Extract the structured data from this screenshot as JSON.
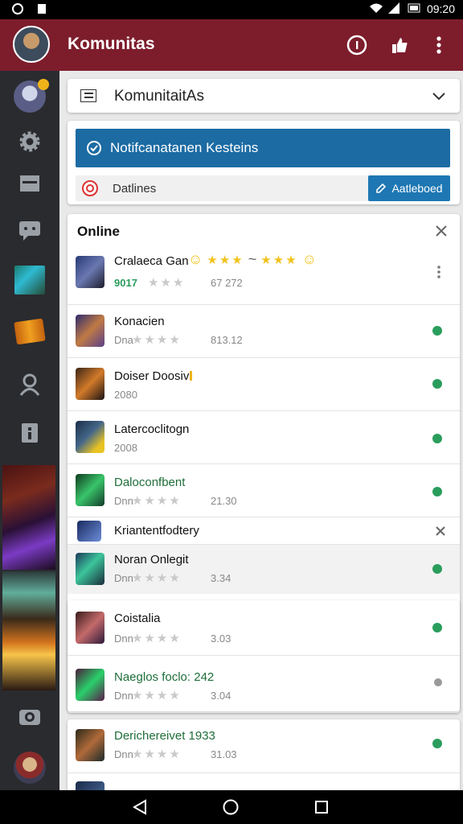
{
  "statusbar": {
    "time": "09:20"
  },
  "appbar": {
    "title": "Komunitas"
  },
  "dropdown": {
    "label": "KomunitaitAs"
  },
  "notification": {
    "label": "Notifcanatanen Kesteins"
  },
  "deal": {
    "label": "Datlines",
    "button": "Aatleboed"
  },
  "online": {
    "header": "Online",
    "rows": [
      {
        "name": "Cralaeca Gan",
        "sub": "9017",
        "meta": "67 272",
        "status": "menu"
      },
      {
        "name": "Konacien",
        "sub": "Dna",
        "meta": "813.12",
        "status": "green"
      },
      {
        "name": "Doiser Doosiv",
        "sub": "2080",
        "meta": "",
        "status": "green"
      },
      {
        "name": "Latercoclitogn",
        "sub": "2008",
        "meta": "",
        "status": "green"
      },
      {
        "name": "Daloconfbent",
        "sub": "Dnn",
        "meta": "21.30",
        "status": "green"
      },
      {
        "name": "Kriantentfodtery",
        "sub": "",
        "meta": "",
        "status": "close"
      },
      {
        "name": "Noran Onlegit",
        "sub": "Dnn",
        "meta": "3.34",
        "status": "green"
      }
    ]
  },
  "list2": {
    "rows": [
      {
        "name": "Coistalia",
        "sub": "Dnn",
        "meta": "3.03",
        "status": "green"
      },
      {
        "name": "Naeglos foclo: 242",
        "sub": "Dnn",
        "meta": "3.04",
        "status": "grey"
      }
    ]
  },
  "list3": {
    "rows": [
      {
        "name": "Derichereivet 1933",
        "sub": "Dnn",
        "meta": "31.03",
        "status": "green"
      }
    ]
  },
  "icons": [
    "settings-icon",
    "card-icon",
    "chat-icon",
    "user-icon",
    "info-icon",
    "camera-icon"
  ]
}
